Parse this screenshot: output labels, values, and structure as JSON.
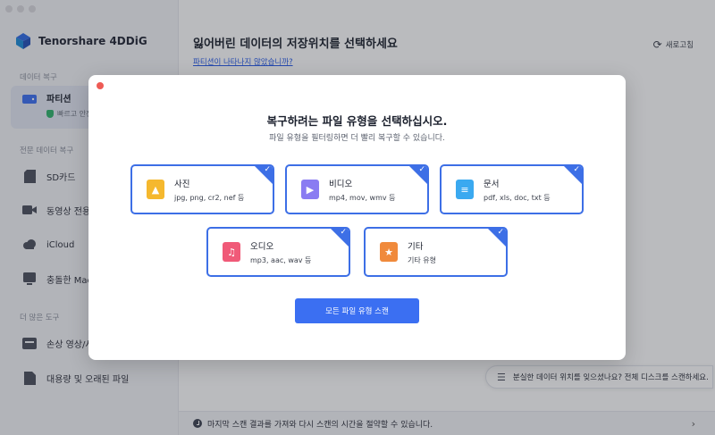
{
  "app": {
    "name": "Tenorshare 4DDiG"
  },
  "sidebar": {
    "sections": [
      {
        "label": "데이터 복구"
      },
      {
        "label": "전문 데이터 복구"
      },
      {
        "label": "더 많은 도구"
      }
    ],
    "items": [
      {
        "label": "파티션",
        "sub": "빠르고 안전"
      },
      {
        "label": "SD카드"
      },
      {
        "label": "동영상 전용"
      },
      {
        "label": "iCloud"
      },
      {
        "label": "충돌한 Mac"
      },
      {
        "label": "손상 영상/사"
      },
      {
        "label": "대용량 및 오래된 파일"
      }
    ]
  },
  "main": {
    "title": "잃어버린 데이터의 저장위치를 선택하세요",
    "link": "파티션이 나타나지 않았습니까?",
    "refresh_label": "새로고침",
    "scan_all_tip": "분실한 데이터 위치를 잊으셨나요? 전체 디스크를 스캔하세요.",
    "bottom_bar": "마지막 스캔 결과를 가져와 다시 스캔의 시간을 절약할 수 있습니다."
  },
  "modal": {
    "title": "복구하려는 파일 유형을 선택하십시오.",
    "subtitle": "파일 유형을 필터링하면 더 빨리 복구할 수 있습니다.",
    "file_types": [
      {
        "name": "사진",
        "desc": "jpg, png, cr2, nef 등",
        "icon": "photo-icon",
        "color": "#f5b82e",
        "checked": true
      },
      {
        "name": "비디오",
        "desc": "mp4, mov, wmv 등",
        "icon": "video-icon",
        "color": "#8a7cf2",
        "checked": true
      },
      {
        "name": "문서",
        "desc": "pdf, xls, doc, txt 등",
        "icon": "document-icon",
        "color": "#3aa9f0",
        "checked": true
      },
      {
        "name": "오디오",
        "desc": "mp3, aac, wav 등",
        "icon": "audio-icon",
        "color": "#f05a78",
        "checked": true
      },
      {
        "name": "기타",
        "desc": "기타 유형",
        "icon": "other-icon",
        "color": "#f08a3c",
        "checked": true
      }
    ],
    "scan_button": "모든 파일 유형 스캔"
  },
  "colors": {
    "accent": "#3d6fe6",
    "button": "#3b6ff2",
    "close": "#ee5b55"
  }
}
